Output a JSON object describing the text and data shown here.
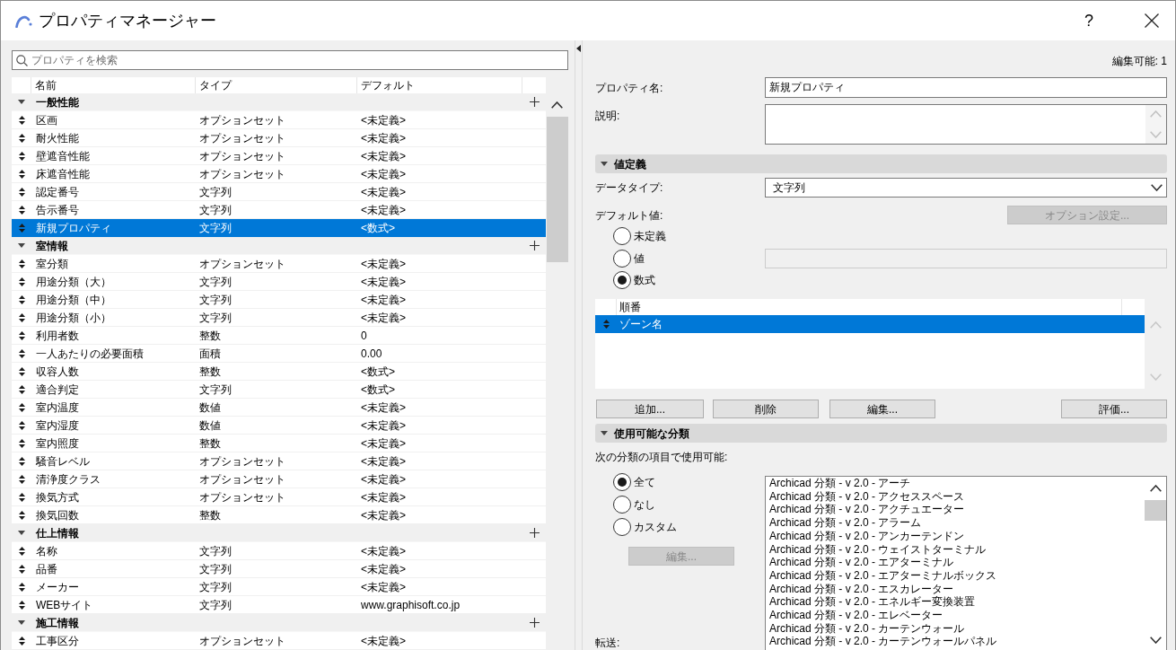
{
  "window": {
    "title": "プロパティマネージャー",
    "help": "?"
  },
  "search": {
    "placeholder": "プロパティを検索"
  },
  "table": {
    "columns": [
      "名前",
      "タイプ",
      "デフォルト"
    ],
    "groups": [
      {
        "name": "一般性能",
        "expanded": true,
        "rows": [
          {
            "name": "区画",
            "type": "オプションセット",
            "default": "<未定義>",
            "selected": false
          },
          {
            "name": "耐火性能",
            "type": "オプションセット",
            "default": "<未定義>",
            "selected": false
          },
          {
            "name": "壁遮音性能",
            "type": "オプションセット",
            "default": "<未定義>",
            "selected": false
          },
          {
            "name": "床遮音性能",
            "type": "オプションセット",
            "default": "<未定義>",
            "selected": false
          },
          {
            "name": "認定番号",
            "type": "文字列",
            "default": "<未定義>",
            "selected": false
          },
          {
            "name": "告示番号",
            "type": "文字列",
            "default": "<未定義>",
            "selected": false
          },
          {
            "name": "新規プロパティ",
            "type": "文字列",
            "default": "<数式>",
            "selected": true
          }
        ]
      },
      {
        "name": "室情報",
        "expanded": true,
        "rows": [
          {
            "name": "室分類",
            "type": "オプションセット",
            "default": "<未定義>",
            "selected": false
          },
          {
            "name": "用途分類（大）",
            "type": "文字列",
            "default": "<未定義>",
            "selected": false
          },
          {
            "name": "用途分類（中）",
            "type": "文字列",
            "default": "<未定義>",
            "selected": false
          },
          {
            "name": "用途分類（小）",
            "type": "文字列",
            "default": "<未定義>",
            "selected": false
          },
          {
            "name": "利用者数",
            "type": "整数",
            "default": "0",
            "selected": false
          },
          {
            "name": "一人あたりの必要面積",
            "type": "面積",
            "default": "0.00",
            "selected": false
          },
          {
            "name": "収容人数",
            "type": "整数",
            "default": "<数式>",
            "selected": false
          },
          {
            "name": "適合判定",
            "type": "文字列",
            "default": "<数式>",
            "selected": false
          },
          {
            "name": "室内温度",
            "type": "数値",
            "default": "<未定義>",
            "selected": false
          },
          {
            "name": "室内湿度",
            "type": "数値",
            "default": "<未定義>",
            "selected": false
          },
          {
            "name": "室内照度",
            "type": "整数",
            "default": "<未定義>",
            "selected": false
          },
          {
            "name": "騒音レベル",
            "type": "オプションセット",
            "default": "<未定義>",
            "selected": false
          },
          {
            "name": "清浄度クラス",
            "type": "オプションセット",
            "default": "<未定義>",
            "selected": false
          },
          {
            "name": "換気方式",
            "type": "オプションセット",
            "default": "<未定義>",
            "selected": false
          },
          {
            "name": "換気回数",
            "type": "整数",
            "default": "<未定義>",
            "selected": false
          }
        ]
      },
      {
        "name": "仕上情報",
        "expanded": true,
        "rows": [
          {
            "name": "名称",
            "type": "文字列",
            "default": "<未定義>",
            "selected": false
          },
          {
            "name": "品番",
            "type": "文字列",
            "default": "<未定義>",
            "selected": false
          },
          {
            "name": "メーカー",
            "type": "文字列",
            "default": "<未定義>",
            "selected": false
          },
          {
            "name": "WEBサイト",
            "type": "文字列",
            "default": "www.graphisoft.co.jp",
            "selected": false
          }
        ]
      },
      {
        "name": "施工情報",
        "expanded": true,
        "rows": [
          {
            "name": "工事区分",
            "type": "オプションセット",
            "default": "<未定義>",
            "selected": false
          }
        ]
      }
    ]
  },
  "details": {
    "editable_count": "編集可能: 1",
    "property_name": {
      "label": "プロパティ名:",
      "value": "新規プロパティ"
    },
    "description": {
      "label": "説明:"
    },
    "value_definition": {
      "title": "値定義",
      "expanded": true,
      "data_type": {
        "label": "データタイプ:",
        "value": "文字列"
      },
      "default_value": {
        "label": "デフォルト値:",
        "options_button": {
          "label": "オプション設定...",
          "disabled": true
        },
        "options": [
          {
            "label": "未定義",
            "selected": false
          },
          {
            "label": "値",
            "selected": false,
            "field": {
              "disabled": true
            }
          },
          {
            "label": "数式",
            "selected": true
          }
        ]
      },
      "formula_list": {
        "columns": [
          "順番"
        ],
        "rows": [
          {
            "name": "ゾーン名",
            "selected": true
          }
        ]
      },
      "buttons": [
        {
          "label": "追加...",
          "disabled": false
        },
        {
          "label": "削除",
          "disabled": false
        },
        {
          "label": "編集...",
          "disabled": false
        },
        {
          "label": "評価...",
          "disabled": false
        }
      ]
    },
    "classification": {
      "title": "使用可能な分類",
      "expanded": true,
      "label": "次の分類の項目で使用可能:",
      "options": [
        {
          "label": "全て",
          "selected": true
        },
        {
          "label": "なし",
          "selected": false
        },
        {
          "label": "カスタム",
          "selected": false
        }
      ],
      "edit_button": {
        "label": "編集...",
        "disabled": true
      },
      "items": [
        "Archicad 分類 - v 2.0 - アーチ",
        "Archicad 分類 - v 2.0 - アクセススペース",
        "Archicad 分類 - v 2.0 - アクチュエーター",
        "Archicad 分類 - v 2.0 - アラーム",
        "Archicad 分類 - v 2.0 - アンカーテンドン",
        "Archicad 分類 - v 2.0 - ウェイストターミナル",
        "Archicad 分類 - v 2.0 - エアターミナル",
        "Archicad 分類 - v 2.0 - エアターミナルボックス",
        "Archicad 分類 - v 2.0 - エスカレーター",
        "Archicad 分類 - v 2.0 - エネルギー変換装置",
        "Archicad 分類 - v 2.0 - エレベーター",
        "Archicad 分類 - v 2.0 - カーテンウォール",
        "Archicad 分類 - v 2.0 - カーテンウォールパネル"
      ]
    },
    "transfer": {
      "label": "転送:"
    }
  }
}
